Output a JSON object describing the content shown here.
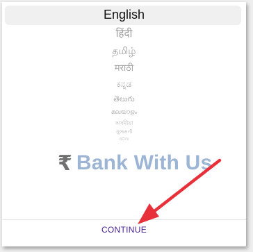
{
  "language_picker": {
    "selected": "English",
    "options": [
      "हिंदी",
      "தமிழ்",
      "मराठी",
      "ಕನ್ನಡ",
      "తెలుగు",
      "മലയാളം",
      "অসমীয়া",
      "ગુજરાતી",
      "ଓଡ଼ିଆ"
    ]
  },
  "brand": {
    "currency_symbol": "₹",
    "name": "Bank With Us"
  },
  "footer": {
    "continue_label": "CONTINUE"
  },
  "annotation": {
    "arrow_color": "#e8303a",
    "arrow_icon": "red-arrow-icon"
  }
}
